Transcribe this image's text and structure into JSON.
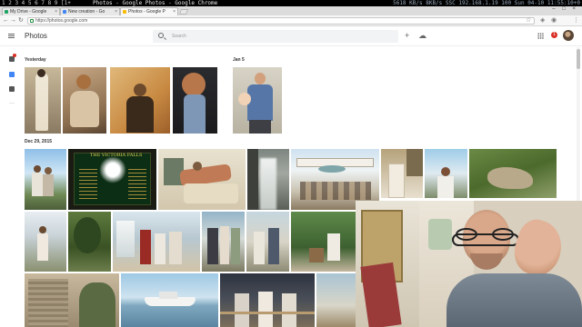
{
  "status_bar": {
    "workspaces": "1  2  3  4  5  6  7  8  9 [1+",
    "window_title": "Photos - Google Photos - Google Chrome",
    "status": "5618 KB/s 8KB/s SSC   192.168.1.19 100 Sun 04-10 11:55:10+0"
  },
  "browser": {
    "tabs": [
      {
        "label": "My Drive - Google",
        "favicon": "drive-icon",
        "color": "#1fa463"
      },
      {
        "label": "New creation - Go",
        "favicon": "docs-icon",
        "color": "#4285f4"
      },
      {
        "label": "Photos - Google P",
        "favicon": "photos-icon",
        "color": "#fbbc04",
        "active": true
      }
    ],
    "url": "https://photos.google.com"
  },
  "app": {
    "title": "Photos",
    "search_placeholder": "Search",
    "notification_count": "1",
    "accent": "#d93025"
  },
  "sections": [
    {
      "label": "Yesterday",
      "photo_count": 4
    },
    {
      "label": "Jan 5",
      "photo_count": 1
    },
    {
      "label": "Dec 29, 2015",
      "photo_count": 19
    }
  ],
  "photo_texts": {
    "falls_sign": "THE VICTORIA FALLS"
  }
}
